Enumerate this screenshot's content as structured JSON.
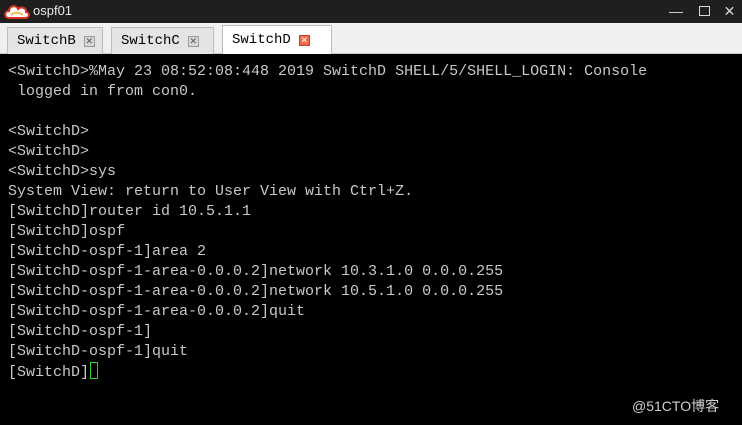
{
  "window": {
    "title": "ospf01"
  },
  "tabs": [
    {
      "label": "SwitchB",
      "active": false
    },
    {
      "label": "SwitchC",
      "active": false
    },
    {
      "label": "SwitchD",
      "active": true
    }
  ],
  "terminal": {
    "lines": [
      "<SwitchD>%May 23 08:52:08:448 2019 SwitchD SHELL/5/SHELL_LOGIN: Console",
      " logged in from con0.",
      "",
      "<SwitchD>",
      "<SwitchD>",
      "<SwitchD>sys",
      "System View: return to User View with Ctrl+Z.",
      "[SwitchD]router id 10.5.1.1",
      "[SwitchD]ospf",
      "[SwitchD-ospf-1]area 2",
      "[SwitchD-ospf-1-area-0.0.0.2]network 10.3.1.0 0.0.0.255",
      "[SwitchD-ospf-1-area-0.0.0.2]network 10.5.1.0 0.0.0.255",
      "[SwitchD-ospf-1-area-0.0.0.2]quit",
      "[SwitchD-ospf-1]",
      "[SwitchD-ospf-1]quit",
      "[SwitchD]"
    ]
  },
  "watermark": "@51CTO博客",
  "colors": {
    "terminal_bg": "#000000",
    "terminal_text": "#c8c8c8",
    "cursor": "#24d024",
    "active_tab_close": "#f36a4a"
  },
  "icons": {
    "app": "cloud-icon",
    "minimize": "minimize-icon",
    "maximize": "maximize-icon",
    "close": "close-icon",
    "tab_close": "tab-close-icon"
  }
}
